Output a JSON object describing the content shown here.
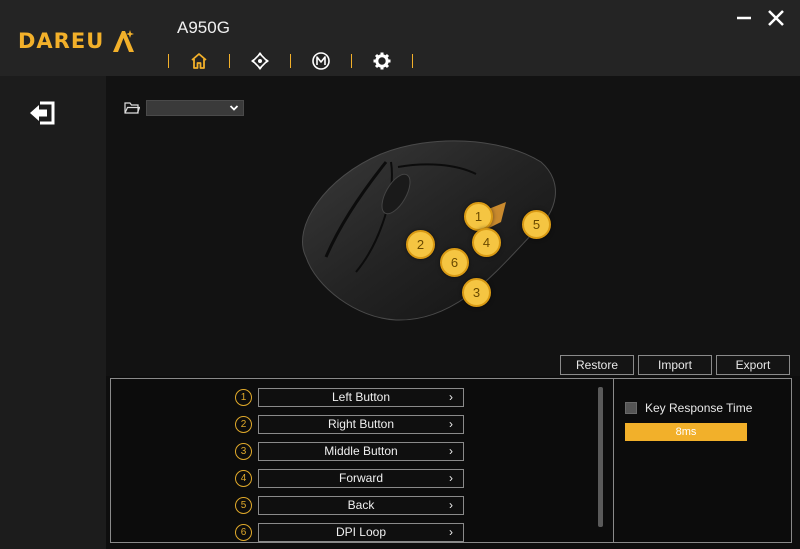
{
  "app": {
    "brand": "DAREU",
    "model": "A950G"
  },
  "nav": {
    "tabs": [
      {
        "name": "home",
        "icon": "home-icon",
        "active": true
      },
      {
        "name": "dpi",
        "icon": "dpi-icon",
        "active": false
      },
      {
        "name": "macro",
        "icon": "macro-icon",
        "active": false
      },
      {
        "name": "settings",
        "icon": "gear-icon",
        "active": false
      }
    ],
    "accent": "#f2b02a"
  },
  "markers": [
    "1",
    "2",
    "3",
    "4",
    "5",
    "6"
  ],
  "actions": {
    "restore": "Restore",
    "import": "Import",
    "export": "Export"
  },
  "keys": [
    {
      "num": "1",
      "label": "Left Button"
    },
    {
      "num": "2",
      "label": "Right Button"
    },
    {
      "num": "3",
      "label": "Middle Button"
    },
    {
      "num": "4",
      "label": "Forward"
    },
    {
      "num": "5",
      "label": "Back"
    },
    {
      "num": "6",
      "label": "DPI Loop"
    }
  ],
  "response": {
    "label": "Key Response Time",
    "value": "8ms"
  }
}
